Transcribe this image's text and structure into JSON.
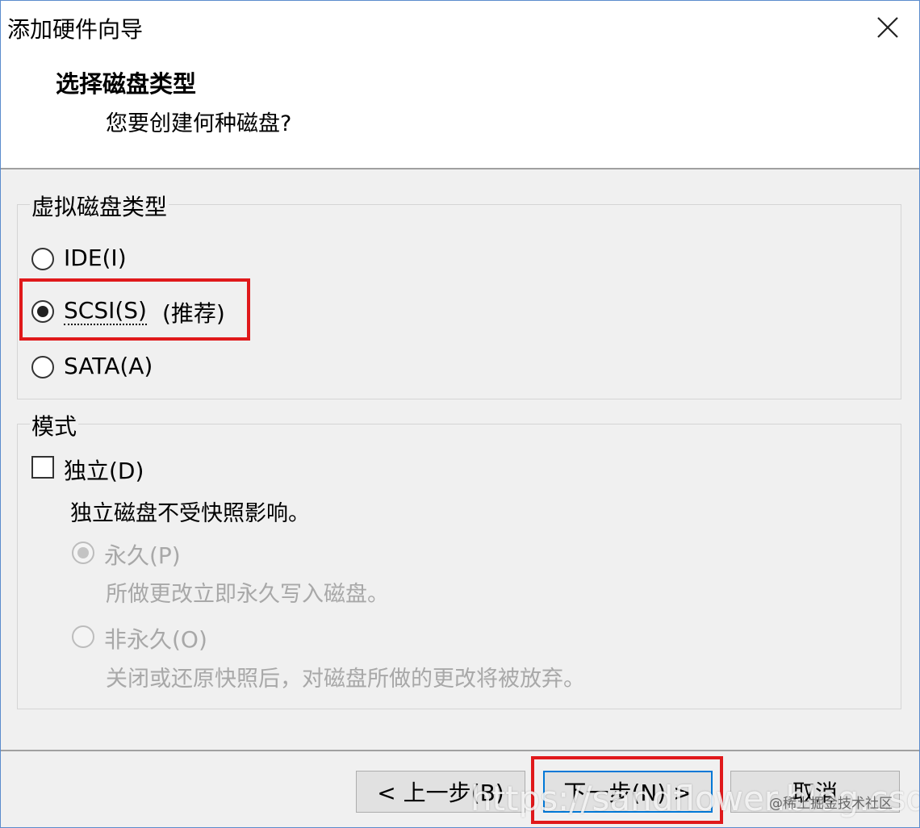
{
  "window": {
    "title": "添加硬件向导"
  },
  "header": {
    "title": "选择磁盘类型",
    "subtitle": "您要创建何种磁盘?"
  },
  "disk_type": {
    "group_label": "虚拟磁盘类型",
    "options": [
      {
        "label": "IDE(I)",
        "checked": false
      },
      {
        "label": "SCSI(S)",
        "suffix": "(推荐)",
        "checked": true
      },
      {
        "label": "SATA(A)",
        "checked": false
      }
    ]
  },
  "mode": {
    "group_label": "模式",
    "independent": {
      "label": "独立(D)",
      "checked": false
    },
    "independent_desc": "独立磁盘不受快照影响。",
    "persistent": {
      "label": "永久(P)",
      "desc": "所做更改立即永久写入磁盘。",
      "checked": true,
      "disabled": true
    },
    "nonpersistent": {
      "label": "非永久(O)",
      "desc": "关闭或还原快照后，对磁盘所做的更改将被放弃。",
      "checked": false,
      "disabled": true
    }
  },
  "footer": {
    "back_label": "< 上一步(B)",
    "next_label": "下一步(N) >",
    "cancel_label": "取消"
  },
  "watermark": {
    "url_text": "https://sandflower.blog.csdn.net",
    "site_text": "@稀土掘金技术社区"
  },
  "colors": {
    "highlight": "#e0191b",
    "focus": "#0078d7",
    "window_border": "#5b8ccd"
  }
}
